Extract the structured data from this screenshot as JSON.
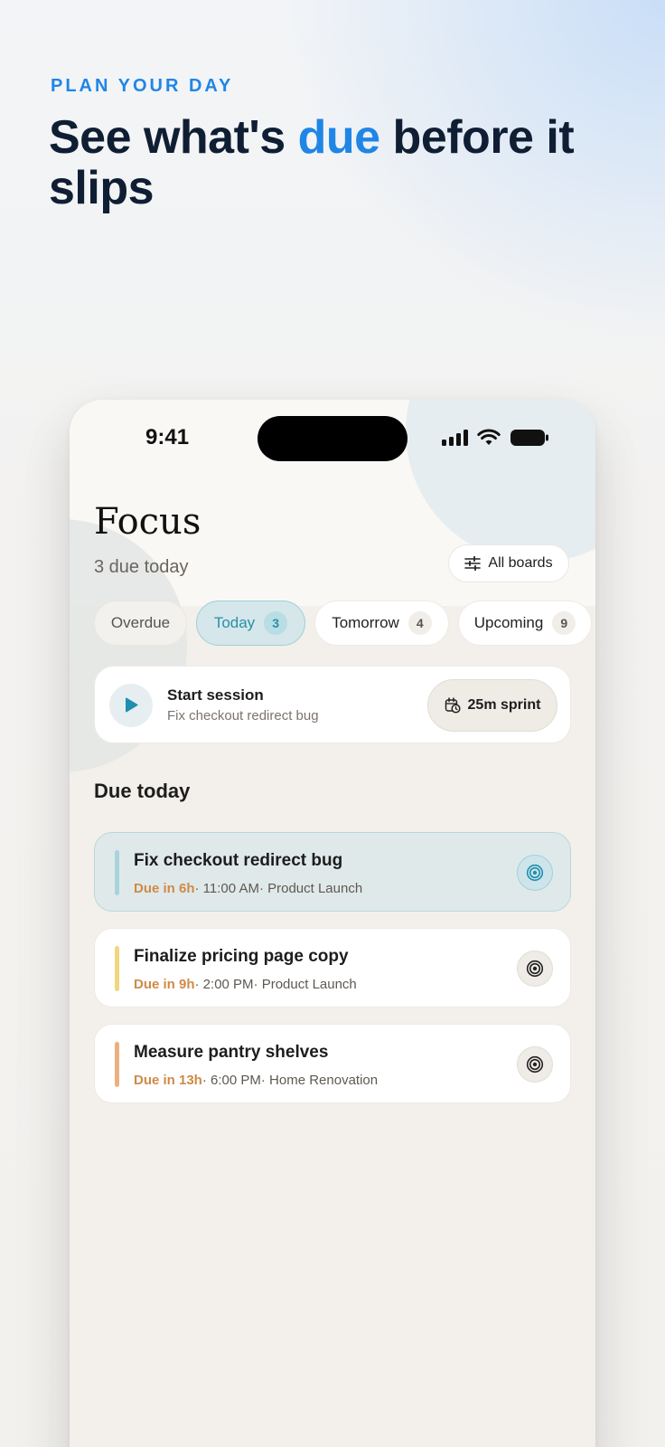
{
  "marketing": {
    "eyebrow": "PLAN YOUR DAY",
    "headline_part1": "See what's ",
    "headline_accent": "due",
    "headline_part2": " before it slips"
  },
  "status_bar": {
    "time": "9:41"
  },
  "header": {
    "title": "Focus",
    "subtitle": "3 due today",
    "boards_button": "All boards"
  },
  "filters": [
    {
      "label": "Overdue",
      "count": null,
      "active": false
    },
    {
      "label": "Today",
      "count": "3",
      "active": true
    },
    {
      "label": "Tomorrow",
      "count": "4",
      "active": false
    },
    {
      "label": "Upcoming",
      "count": "9",
      "active": false
    }
  ],
  "session": {
    "title": "Start session",
    "task": "Fix checkout redirect bug",
    "sprint_label": "25m sprint"
  },
  "section": {
    "title": "Due today"
  },
  "tasks": [
    {
      "title": "Fix checkout redirect bug",
      "due": "Due in 6h",
      "meta": "· 11:00 AM· Product Launch",
      "color": "#a8d4dc",
      "active": true
    },
    {
      "title": "Finalize pricing page copy",
      "due": "Due in 9h",
      "meta": "· 2:00 PM· Product Launch",
      "color": "#f1d67e",
      "active": false
    },
    {
      "title": "Measure pantry shelves",
      "due": "Due in 13h",
      "meta": "· 6:00 PM· Home Renovation",
      "color": "#ecb07e",
      "active": false
    }
  ],
  "colors": {
    "accent": "#1f86e6",
    "teal": "#2a8fa6",
    "due_orange": "#cf8a47",
    "headline": "#0f1e33"
  },
  "icons": {
    "filter": "sliders-icon",
    "play": "play-icon",
    "calendar": "calendar-clock-icon",
    "target": "target-icon"
  }
}
